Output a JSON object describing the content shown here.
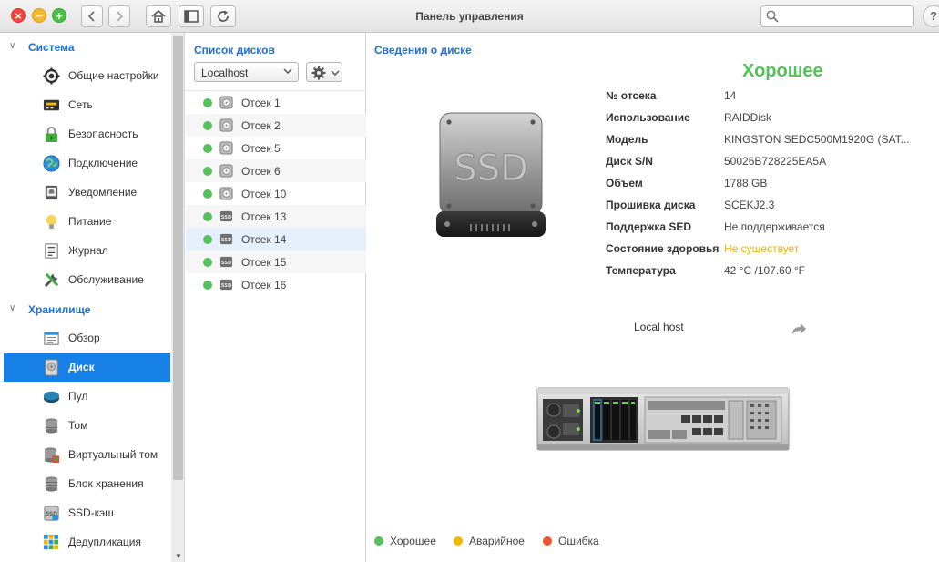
{
  "window": {
    "title": "Панель управления",
    "search_placeholder": "",
    "help_label": "?"
  },
  "sidebar": {
    "sections": [
      {
        "label": "Система",
        "items": [
          {
            "label": "Общие настройки",
            "icon": "gear-wheel-icon"
          },
          {
            "label": "Сеть",
            "icon": "network-card-icon"
          },
          {
            "label": "Безопасность",
            "icon": "padlock-icon"
          },
          {
            "label": "Подключение",
            "icon": "globe-icon"
          },
          {
            "label": "Уведомление",
            "icon": "notification-icon"
          },
          {
            "label": "Питание",
            "icon": "lightbulb-icon"
          },
          {
            "label": "Журнал",
            "icon": "log-icon"
          },
          {
            "label": "Обслуживание",
            "icon": "tools-icon"
          }
        ]
      },
      {
        "label": "Хранилище",
        "items": [
          {
            "label": "Обзор",
            "icon": "overview-icon"
          },
          {
            "label": "Диск",
            "icon": "disk-icon",
            "active": true
          },
          {
            "label": "Пул",
            "icon": "pool-icon"
          },
          {
            "label": "Том",
            "icon": "volume-icon"
          },
          {
            "label": "Виртуальный том",
            "icon": "virtual-volume-icon"
          },
          {
            "label": "Блок хранения",
            "icon": "storage-block-icon"
          },
          {
            "label": "SSD-кэш",
            "icon": "ssd-cache-icon"
          },
          {
            "label": "Дедупликация",
            "icon": "dedup-icon"
          }
        ]
      }
    ]
  },
  "disk_list": {
    "title": "Список дисков",
    "host_select": "Localhost",
    "disks": [
      {
        "label": "Отсек 1",
        "type": "hdd"
      },
      {
        "label": "Отсек 2",
        "type": "hdd"
      },
      {
        "label": "Отсек 5",
        "type": "hdd"
      },
      {
        "label": "Отсек 6",
        "type": "hdd"
      },
      {
        "label": "Отсек 10",
        "type": "hdd"
      },
      {
        "label": "Отсек 13",
        "type": "ssd"
      },
      {
        "label": "Отсек 14",
        "type": "ssd",
        "selected": true
      },
      {
        "label": "Отсек 15",
        "type": "ssd"
      },
      {
        "label": "Отсек 16",
        "type": "ssd"
      }
    ],
    "status_color": "#55c15a"
  },
  "details": {
    "title": "Сведения о диске",
    "health": "Хорошее",
    "ssd_label": "SSD",
    "fields": [
      {
        "key": "№ отсека",
        "value": "14"
      },
      {
        "key": "Использование",
        "value": "RAIDDisk"
      },
      {
        "key": "Модель",
        "value": "KINGSTON SEDC500M1920G (SAT..."
      },
      {
        "key": "Диск S/N",
        "value": "50026B728225EA5A"
      },
      {
        "key": "Объем",
        "value": "1788 GB"
      },
      {
        "key": "Прошивка диска",
        "value": "SCEKJ2.3"
      },
      {
        "key": "Поддержка SED",
        "value": "Не поддерживается"
      },
      {
        "key": "Состояние здоровья",
        "value": "Не существует",
        "status": "warning"
      },
      {
        "key": "Температура",
        "value": "42 °C /107.60 °F"
      }
    ],
    "host_label": "Local host"
  },
  "legend": [
    {
      "label": "Хорошее",
      "color": "#55c15a"
    },
    {
      "label": "Аварийное",
      "color": "#f2b705"
    },
    {
      "label": "Ошибка",
      "color": "#f0542d"
    }
  ]
}
